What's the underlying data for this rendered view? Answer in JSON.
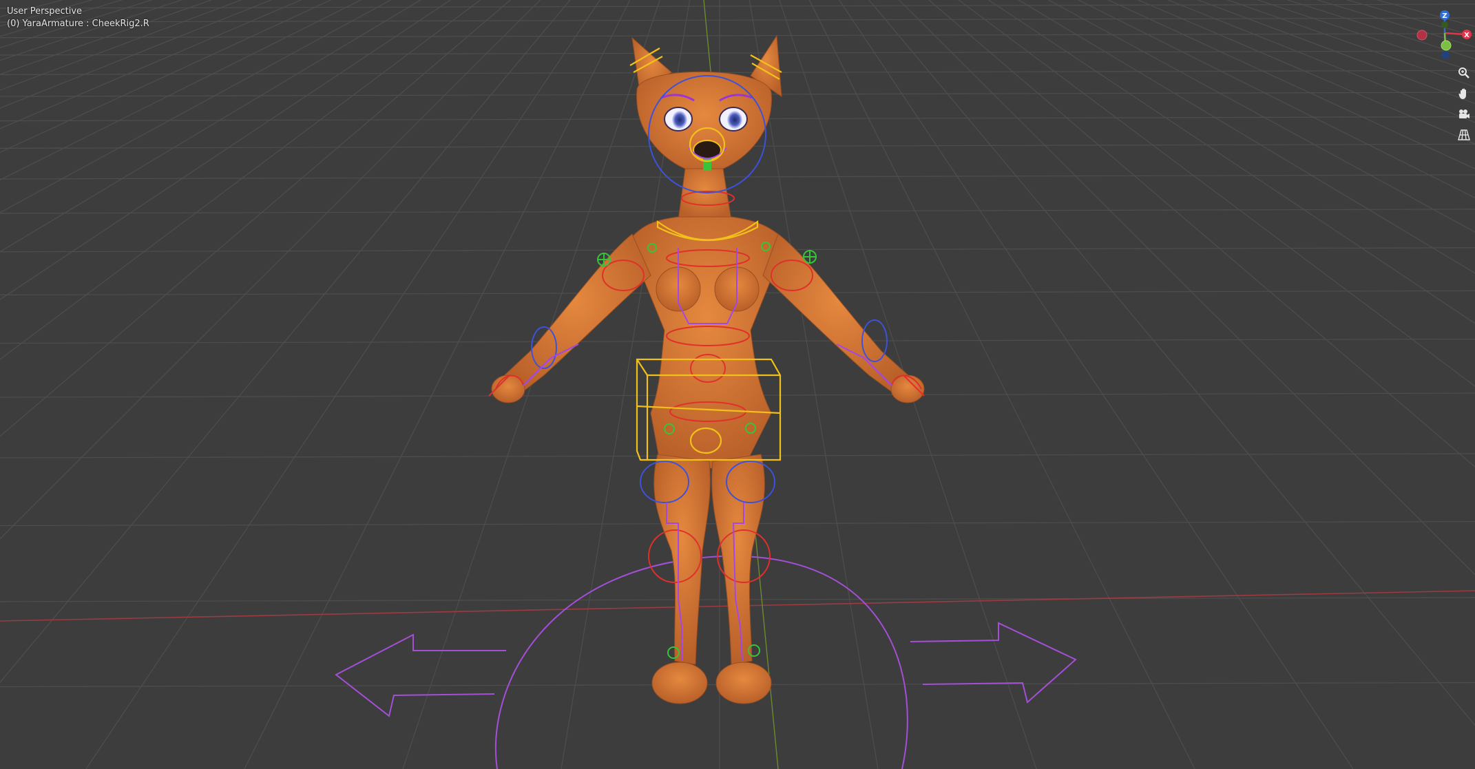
{
  "viewport": {
    "view_name": "User Perspective",
    "object_info": "(0) YaraArmature : CheekRig2.R"
  },
  "gizmo": {
    "z_label": "Z",
    "x_label": "X",
    "z_color": "#2f6fd6",
    "x_color": "#e0354a",
    "y_color": "#7bc043",
    "neg_x_color": "#b03245"
  },
  "nav_buttons": [
    {
      "icon": "zoom-icon"
    },
    {
      "icon": "pan-hand-icon"
    },
    {
      "icon": "camera-icon"
    },
    {
      "icon": "orthographic-grid-icon"
    }
  ],
  "colors": {
    "background": "#3d3d3d",
    "grid": "#4e4e4e",
    "x_axis": "#9c3b42",
    "y_axis": "#6c8a2e",
    "skin": "#d97a35",
    "bone_red": "#e0302b",
    "bone_blue": "#3d52d9",
    "bone_purple": "#a347e8",
    "bone_yellow": "#f2c01a",
    "bone_green": "#38c43a",
    "root_control": "#a44fd8"
  }
}
